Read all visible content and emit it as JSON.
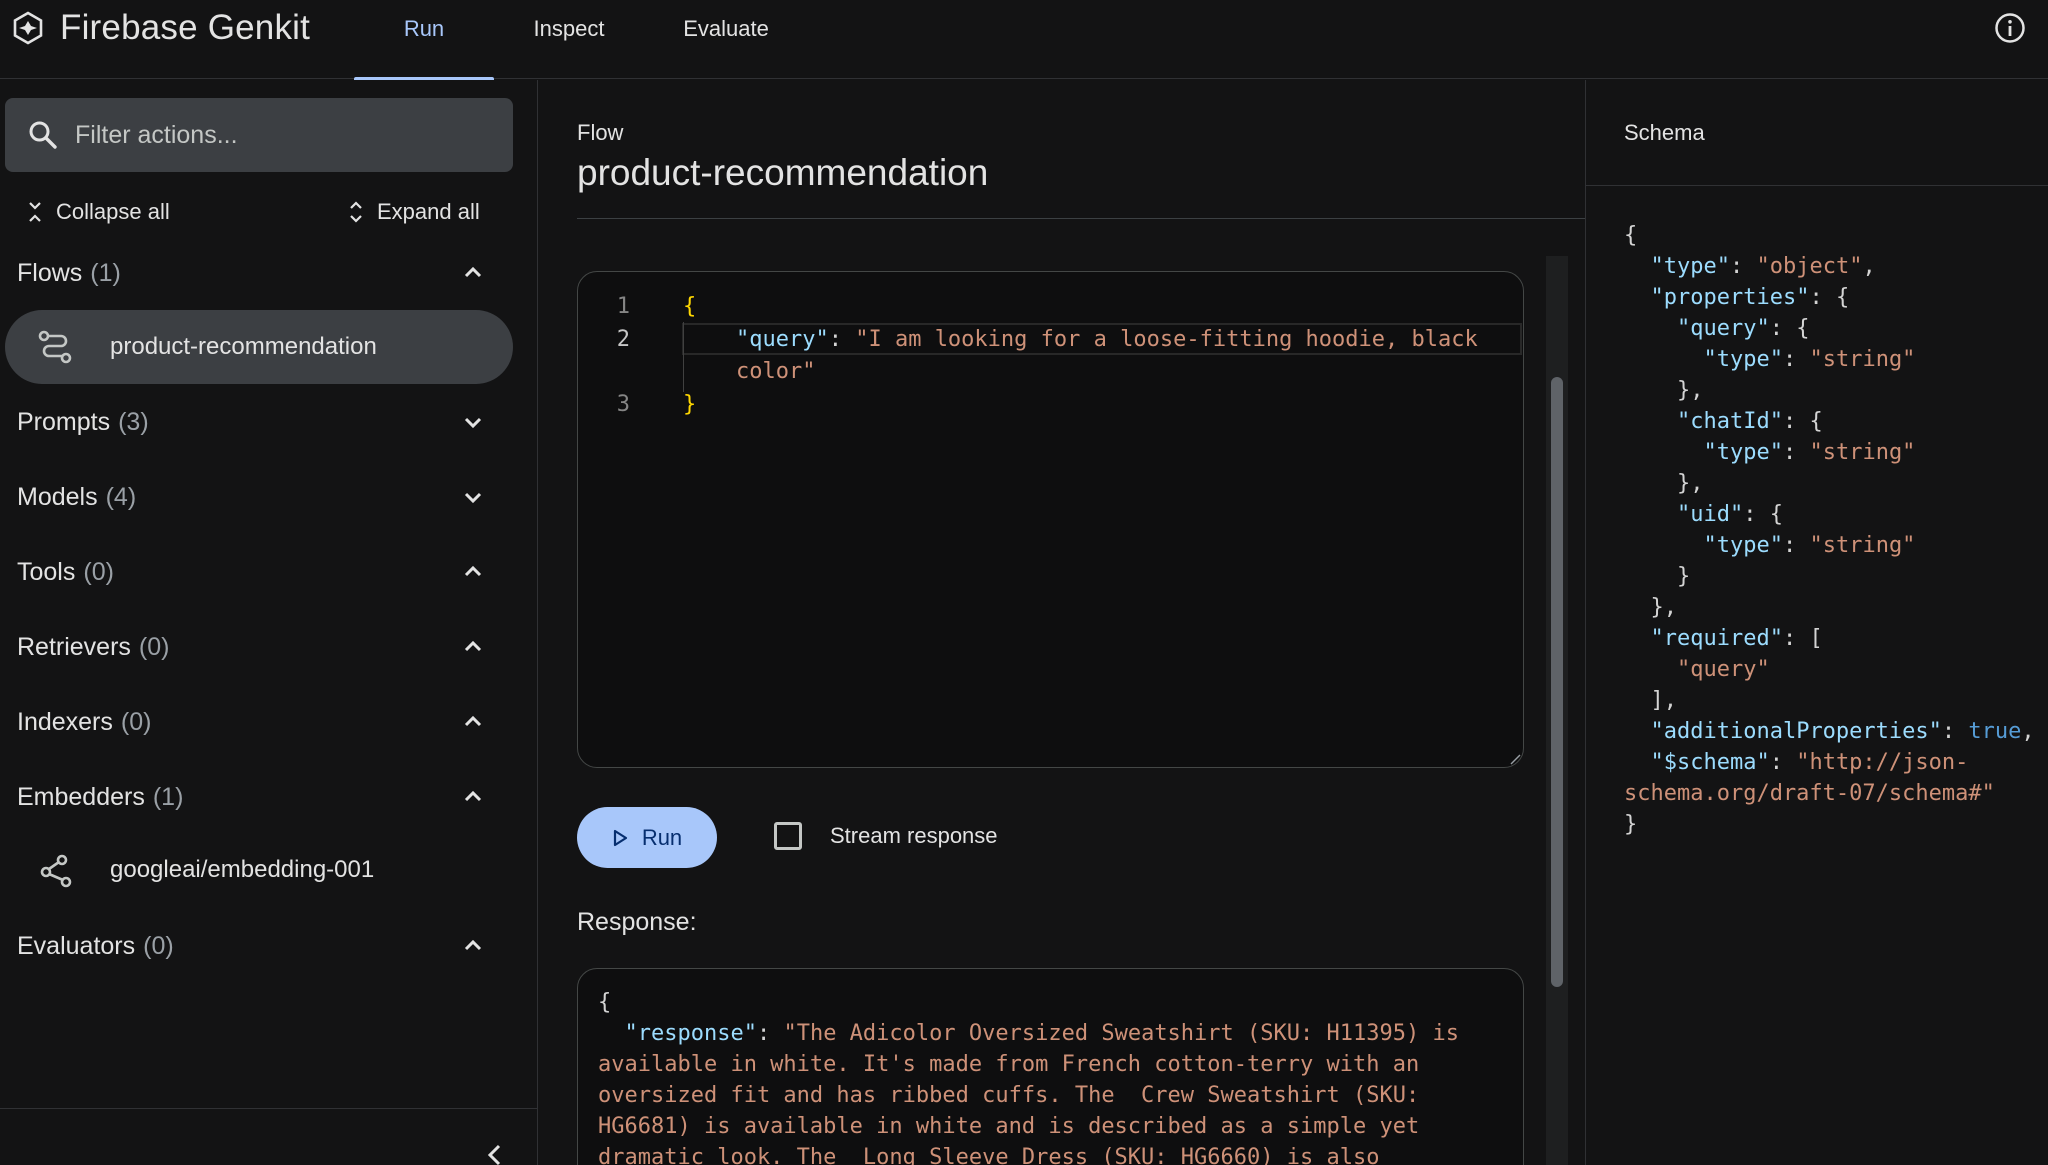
{
  "app": {
    "title": "Firebase Genkit",
    "tabs": [
      {
        "label": "Run",
        "active": true
      },
      {
        "label": "Inspect",
        "active": false
      },
      {
        "label": "Evaluate",
        "active": false
      }
    ]
  },
  "sidebar": {
    "filter_placeholder": "Filter actions...",
    "collapse_all": "Collapse all",
    "expand_all": "Expand all",
    "sections": [
      {
        "label": "Flows",
        "count": "(1)",
        "expanded": true,
        "items": [
          "product-recommendation"
        ]
      },
      {
        "label": "Prompts",
        "count": "(3)",
        "expanded": false
      },
      {
        "label": "Models",
        "count": "(4)",
        "expanded": false
      },
      {
        "label": "Tools",
        "count": "(0)",
        "expanded": true
      },
      {
        "label": "Retrievers",
        "count": "(0)",
        "expanded": true
      },
      {
        "label": "Indexers",
        "count": "(0)",
        "expanded": true
      },
      {
        "label": "Embedders",
        "count": "(1)",
        "expanded": true,
        "items": [
          "googleai/embedding-001"
        ]
      },
      {
        "label": "Evaluators",
        "count": "(0)",
        "expanded": true
      }
    ]
  },
  "main": {
    "kind_label": "Flow",
    "title": "product-recommendation",
    "editor": {
      "line_numbers": [
        "1",
        "2",
        "3"
      ],
      "open_brace": "{",
      "close_brace": "}",
      "key": "\"query\"",
      "colon": ": ",
      "value_part1": "\"I am looking for a loose-fitting hoodie, black",
      "value_part2": "color\""
    },
    "run_label": "Run",
    "stream_label": "Stream response",
    "response_label": "Response:",
    "response_text": "{\n  \"response\": \"The Adicolor Oversized Sweatshirt (SKU: H11395) is available in white. It's made from French cotton-terry with an oversized fit and has ribbed cuffs. The  Crew Sweatshirt (SKU: HG6681) is available in white and is described as a simple yet dramatic look. The  Long Sleeve Dress (SKU: HG6660) is also"
  },
  "schema": {
    "title": "Schema",
    "lines": [
      "{",
      "  \"type\": \"object\",",
      "  \"properties\": {",
      "    \"query\": {",
      "      \"type\": \"string\"",
      "    },",
      "    \"chatId\": {",
      "      \"type\": \"string\"",
      "    },",
      "    \"uid\": {",
      "      \"type\": \"string\"",
      "    }",
      "  },",
      "  \"required\": [",
      "    \"query\"",
      "  ],",
      "  \"additionalProperties\": true,",
      "  \"$schema\": \"http://json-",
      "schema.org/draft-07/schema#\"",
      "}"
    ]
  },
  "colors": {
    "accent": "#a8c7fa",
    "background": "#131314",
    "json_key": "#9cdcfe",
    "json_string": "#ce9178",
    "json_keyword": "#569cd6"
  }
}
